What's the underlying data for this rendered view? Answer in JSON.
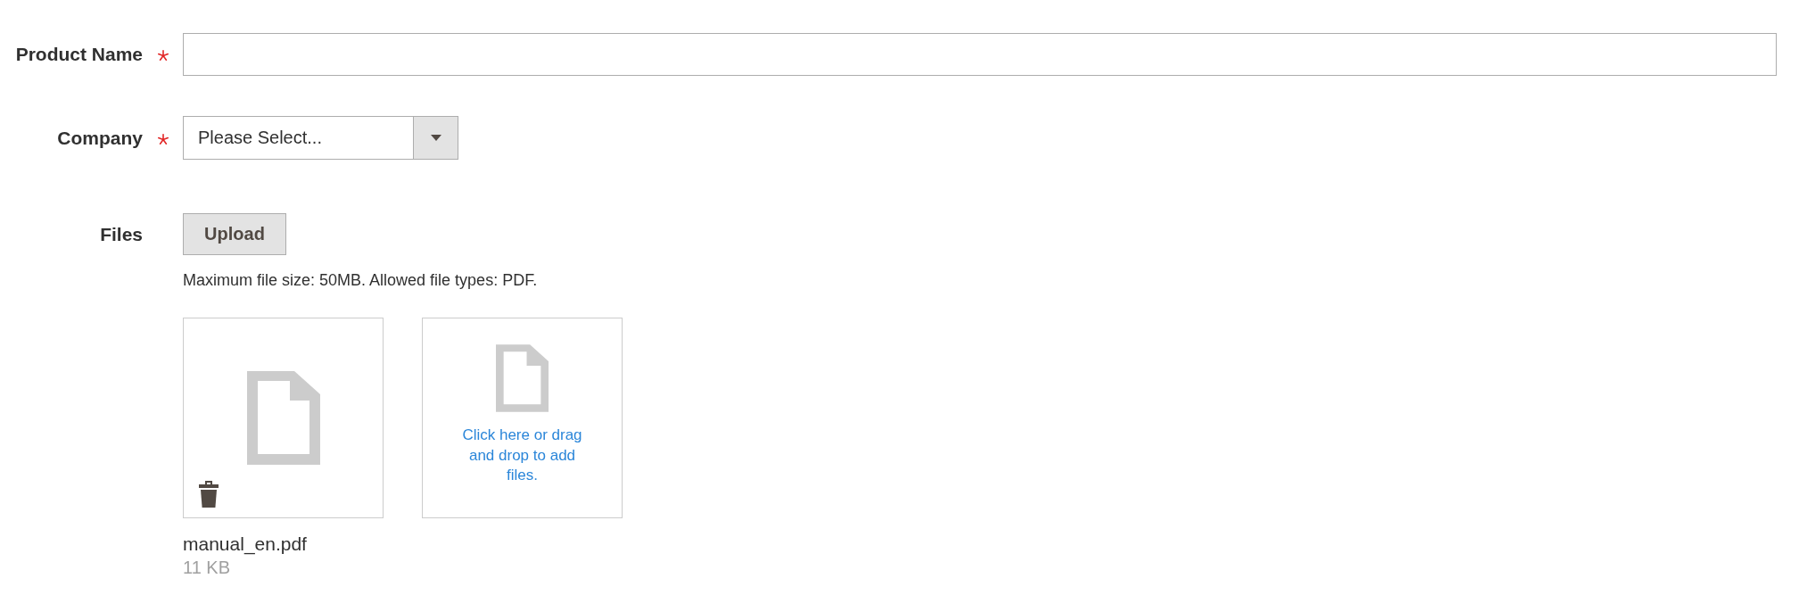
{
  "form": {
    "fields": [
      {
        "kind": "text",
        "label": "Product Name",
        "required": true
      },
      {
        "kind": "select",
        "label": "Company",
        "required": true,
        "value": "Please Select..."
      },
      {
        "kind": "files",
        "label": "Files",
        "required": false,
        "button": "Upload",
        "note": "Maximum file size: 50MB. Allowed file types: PDF.",
        "files": [
          {
            "name": "manual_en.pdf",
            "size": "11 KB"
          }
        ],
        "dropzone": "Click here or drag and drop to add files."
      }
    ]
  }
}
